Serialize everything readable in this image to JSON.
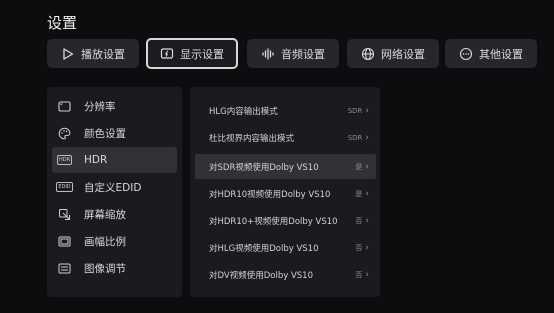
{
  "title": "设置",
  "tabs": [
    {
      "label": "播放设置",
      "icon": "play-icon"
    },
    {
      "label": "显示设置",
      "icon": "display-icon"
    },
    {
      "label": "音频设置",
      "icon": "audio-wave-icon"
    },
    {
      "label": "网络设置",
      "icon": "globe-icon"
    },
    {
      "label": "其他设置",
      "icon": "more-icon"
    }
  ],
  "sidebar": {
    "items": [
      {
        "label": "分辨率",
        "icon": "resolution-icon"
      },
      {
        "label": "颜色设置",
        "icon": "palette-icon"
      },
      {
        "label": "HDR",
        "icon": "hdr-icon",
        "icon_text": "HDR"
      },
      {
        "label": "自定义EDID",
        "icon": "edid-icon",
        "icon_text": "EDID"
      },
      {
        "label": "屏幕缩放",
        "icon": "screen-zoom-icon"
      },
      {
        "label": "画幅比例",
        "icon": "aspect-ratio-icon"
      },
      {
        "label": "图像调节",
        "icon": "image-adjust-icon"
      }
    ]
  },
  "options": [
    {
      "label": "HLG内容输出模式",
      "value": "SDR"
    },
    {
      "label": "杜比视界内容输出模式",
      "value": "SDR"
    },
    {
      "label": "对SDR视频使用Dolby VS10",
      "value": "是"
    },
    {
      "label": "对HDR10视频使用Dolby VS10",
      "value": "是"
    },
    {
      "label": "对HDR10+视频使用Dolby VS10",
      "value": "否"
    },
    {
      "label": "对HLG视频使用Dolby VS10",
      "value": "否"
    },
    {
      "label": "对DV视频使用Dolby VS10",
      "value": "否"
    }
  ],
  "chevron": "›"
}
